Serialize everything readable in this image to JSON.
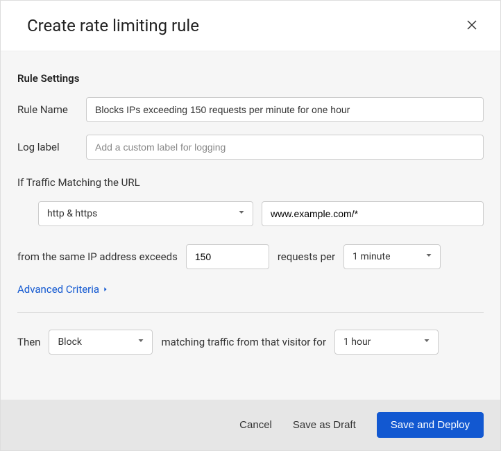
{
  "dialog": {
    "title": "Create rate limiting rule"
  },
  "settings": {
    "section_title": "Rule Settings",
    "rule_name_label": "Rule Name",
    "rule_name_value": "Blocks IPs exceeding 150 requests per minute for one hour",
    "log_label_label": "Log label",
    "log_label_placeholder": "Add a custom label for logging",
    "log_label_value": "",
    "traffic_label": "If Traffic Matching the URL",
    "protocol_value": "http & https",
    "url_value": "www.example.com/*",
    "exceeds_text_pre": "from the same IP address exceeds",
    "request_count": "150",
    "requests_per_text": "requests per",
    "time_window": "1 minute",
    "advanced_text": "Advanced Criteria",
    "then_label": "Then",
    "action_value": "Block",
    "matching_text": "matching traffic from that visitor for",
    "duration_value": "1 hour"
  },
  "footer": {
    "cancel": "Cancel",
    "save_draft": "Save as Draft",
    "save_deploy": "Save and Deploy"
  }
}
